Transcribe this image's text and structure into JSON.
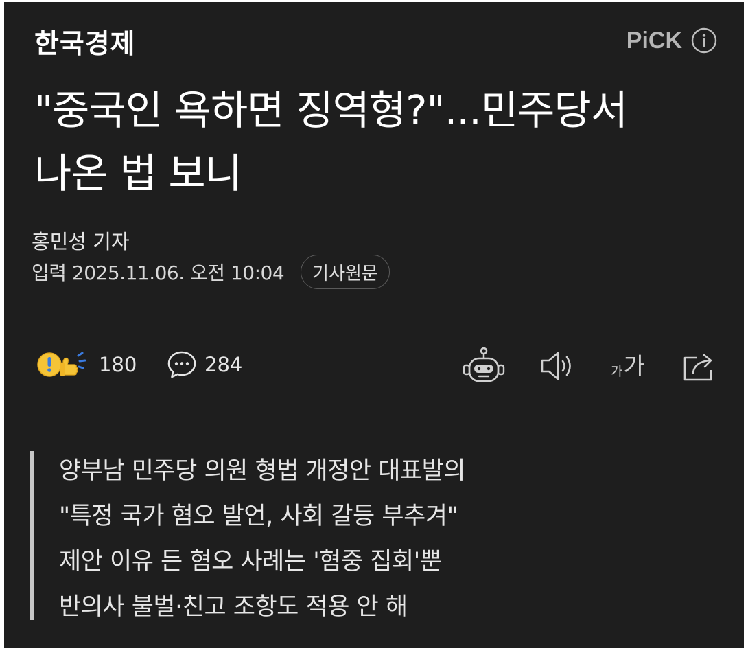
{
  "header": {
    "publisher": "한국경제",
    "pick_label": "PiCK"
  },
  "article": {
    "headline_line1": "\"중국인 욕하면 징역형?\"...민주당서",
    "headline_line2": "나온 법 보니",
    "reporter": "홍민성 기자",
    "published": "입력 2025.11.06. 오전 10:04",
    "source_button": "기사원문"
  },
  "engagement": {
    "reaction_count": "180",
    "comment_count": "284"
  },
  "toolbar": {
    "font_size_small": "가",
    "font_size_large": "가",
    "icons": [
      "robot-summary-icon",
      "speaker-icon",
      "font-size-icon",
      "share-icon"
    ]
  },
  "summary": [
    "양부남 민주당 의원 형법 개정안 대표발의",
    "\"특정 국가 혐오 발언, 사회 갈등 부추겨\"",
    "제안 이유 든 혐오 사례는 '혐중 집회'뿐",
    "반의사 불벌·친고 조항도 적용 안 해"
  ],
  "colors": {
    "background": "#1e1e1e",
    "text": "#ffffff",
    "muted": "#b5b5b5",
    "icon": "#d0d0d0"
  }
}
